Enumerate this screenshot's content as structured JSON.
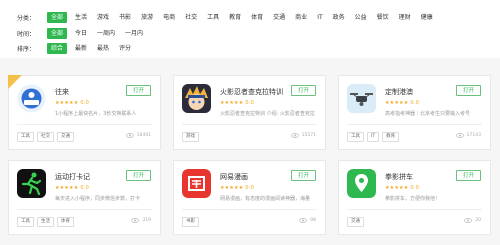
{
  "filters": {
    "category": {
      "label": "分类：",
      "options": [
        "全部",
        "生活",
        "游戏",
        "书影",
        "旅游",
        "电商",
        "社交",
        "工具",
        "教育",
        "体育",
        "交通",
        "商业",
        "IT",
        "政务",
        "公益",
        "餐饮",
        "理财",
        "健康"
      ],
      "active": 0
    },
    "time": {
      "label": "时间：",
      "options": [
        "全部",
        "今日",
        "一周内",
        "一月内"
      ],
      "active": 0
    },
    "sort": {
      "label": "排序：",
      "options": [
        "综合",
        "最新",
        "最热",
        "评分"
      ],
      "active": 0
    }
  },
  "cards": [
    {
      "name": "往来",
      "button": "打开",
      "stars": "★★★★★",
      "score": "0.0",
      "desc": "1小程序上最快名片，3秒交换联系人",
      "tags": [
        "工具",
        "社交",
        "交通"
      ],
      "views": "16491"
    },
    {
      "name": "火影忍者查克拉特训",
      "button": "打开",
      "stars": "★★★★★",
      "score": "0.0",
      "desc": "火影忍者查克拉特训 介绍: 火影忍者查克拉",
      "tags": [
        "游戏"
      ],
      "views": "15571"
    },
    {
      "name": "定制港澳",
      "button": "打开",
      "stars": "★★★★★",
      "score": "0.0",
      "desc": "高考指考神器｜北京考生只要输入考号",
      "tags": [
        "工具",
        "IT",
        "教育"
      ],
      "views": "17143"
    },
    {
      "name": "运动打卡记",
      "button": "打开",
      "stars": "★★★★★",
      "score": "0.0",
      "desc": "每天进入小程序，同步微信步数，打卡",
      "tags": [
        "工具",
        "生活",
        "体育"
      ],
      "views": "319"
    },
    {
      "name": "网易漫画",
      "button": "打开",
      "stars": "★★★★★",
      "score": "0.0",
      "desc": "网易漫画，有态度的漫画阅读神器，海量",
      "tags": [
        "书影"
      ],
      "views": "98"
    },
    {
      "name": "拳影拼车",
      "button": "打开",
      "stars": "★★★★★",
      "score": "0.0",
      "desc": "拳影拼车，方便你我他！",
      "tags": [
        "交通"
      ],
      "views": "20"
    }
  ],
  "icons": [
    "wanglai-logo-icon",
    "naruto-avatar-icon",
    "drone-icon",
    "running-man-icon",
    "netease-comic-icon",
    "location-pin-icon"
  ]
}
